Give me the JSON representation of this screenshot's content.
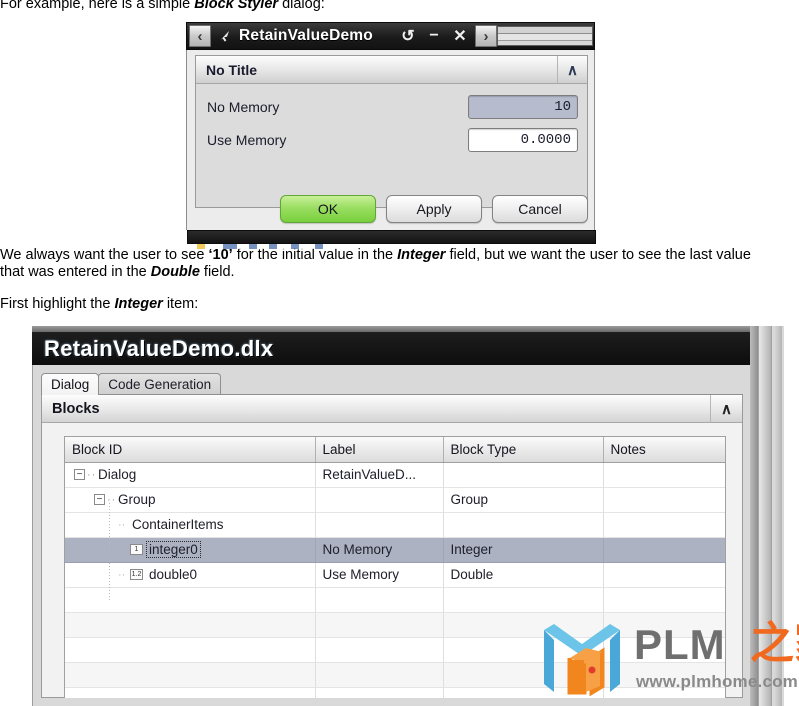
{
  "document": {
    "intro_line": "For example, here is a simple Block Styler dialog:",
    "intro_bold": "Block Styler",
    "para2_a": "We always want the user to see ",
    "para2_quote": "‘10’",
    "para2_b": " for the initial value in the ",
    "para2_bold1": "Integer",
    "para2_c": " field, but we want the user to see the last value that was entered in the ",
    "para2_bold2": "Double",
    "para2_d": " field.",
    "para3_a": "First highlight the ",
    "para3_bold": "Integer",
    "para3_b": " item:"
  },
  "styler_dialog": {
    "title": "RetainValueDemo",
    "nav_back": "‹",
    "nav_forward": "›",
    "cursor_icon": "cursor-arrow-icon",
    "reset_icon": "↺",
    "minimize_icon": "−",
    "close_icon": "✕",
    "group_title": "No Title",
    "collapse_icon": "∧",
    "rows": [
      {
        "label": "No Memory",
        "value": "10",
        "state": "selected"
      },
      {
        "label": "Use Memory",
        "value": "0.0000",
        "state": "plain"
      }
    ],
    "buttons": [
      {
        "label": "OK",
        "style": "ok"
      },
      {
        "label": "Apply",
        "style": "normal"
      },
      {
        "label": "Cancel",
        "style": "normal"
      }
    ]
  },
  "dlx_window": {
    "title": "RetainValueDemo.dlx",
    "tabs": [
      {
        "label": "Dialog",
        "active": true
      },
      {
        "label": "Code Generation",
        "active": false
      }
    ],
    "panel": {
      "title": "Blocks",
      "collapse_icon": "∧"
    },
    "tree": {
      "columns": [
        "Block ID",
        "Label",
        "Block Type",
        "Notes"
      ],
      "rows": [
        {
          "block_id": "Dialog",
          "label": "RetainValueD...",
          "block_type": "",
          "notes": "",
          "indent": 1,
          "expander": "−",
          "icon": "",
          "selected": false
        },
        {
          "block_id": "Group",
          "label": "",
          "block_type": "Group",
          "notes": "",
          "indent": 2,
          "expander": "−",
          "icon": "",
          "selected": false
        },
        {
          "block_id": "ContainerItems",
          "label": "",
          "block_type": "",
          "notes": "",
          "indent": 3,
          "expander": "",
          "icon": "",
          "selected": false
        },
        {
          "block_id": "integer0",
          "label": "No Memory",
          "block_type": "Integer",
          "notes": "",
          "indent": 3,
          "expander": "",
          "icon": "1",
          "selected": true
        },
        {
          "block_id": "double0",
          "label": "Use Memory",
          "block_type": "Double",
          "notes": "",
          "indent": 3,
          "expander": "",
          "icon": "1.2",
          "selected": false
        }
      ],
      "empty_row_count": 5
    }
  },
  "watermark": {
    "logo_icon": "plm-logo-icon",
    "text": "PLM",
    "chinese": "之家",
    "url": "www.plmhome.com"
  }
}
